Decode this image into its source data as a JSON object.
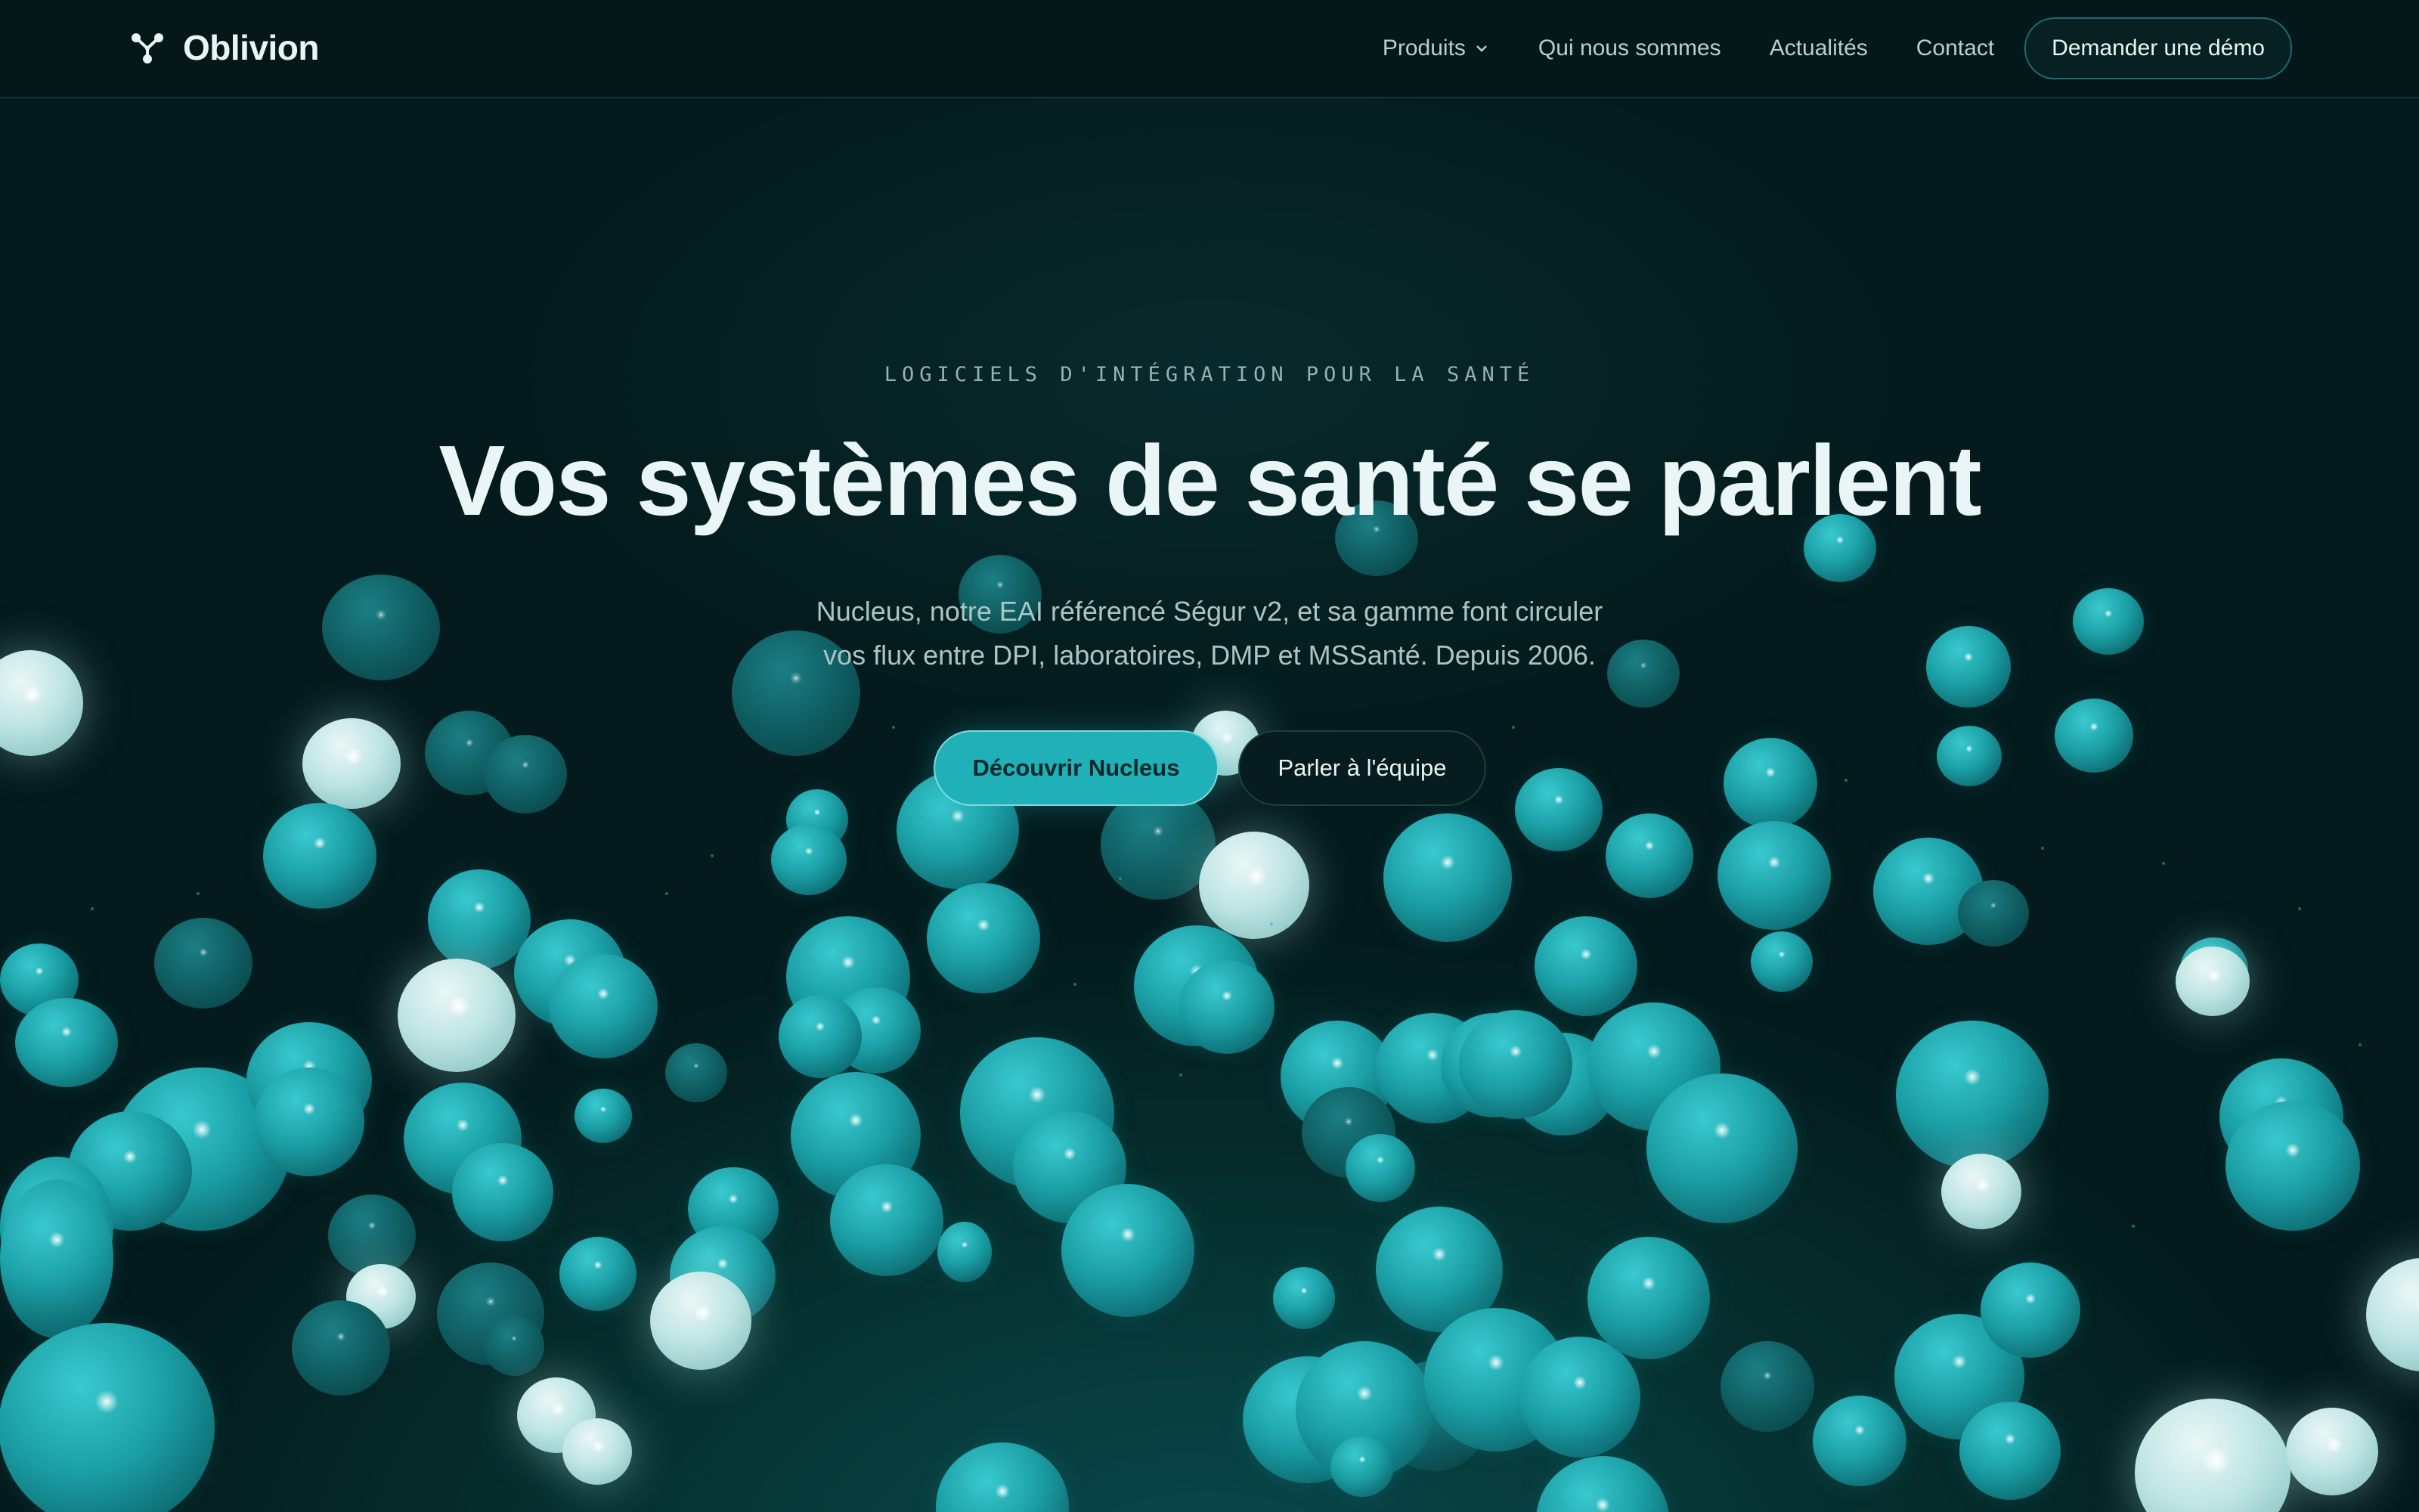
{
  "brand": {
    "name": "Oblivion",
    "accent": "#20b1b8",
    "background": "#041a1c"
  },
  "nav": {
    "items": [
      {
        "label": "Produits",
        "has_dropdown": true
      },
      {
        "label": "Qui nous sommes"
      },
      {
        "label": "Actualités"
      },
      {
        "label": "Contact"
      }
    ],
    "cta_label": "Demander une démo"
  },
  "hero": {
    "eyebrow": "LOGICIELS D'INTÉGRATION POUR LA SANTÉ",
    "title": "Vos systèmes de santé se parlent",
    "subtitle_line1": "Nucleus, notre EAI référencé Ségur v2, et sa gamme font circuler",
    "subtitle_line2": "vos flux entre DPI, laboratoires, DMP et MSSanté. Depuis 2006.",
    "primary_cta": "Découvrir Nucleus",
    "secondary_cta": "Parler à l'équipe"
  },
  "icons": {
    "logo": "molecule-icon",
    "dropdown": "chevron-down-icon"
  }
}
